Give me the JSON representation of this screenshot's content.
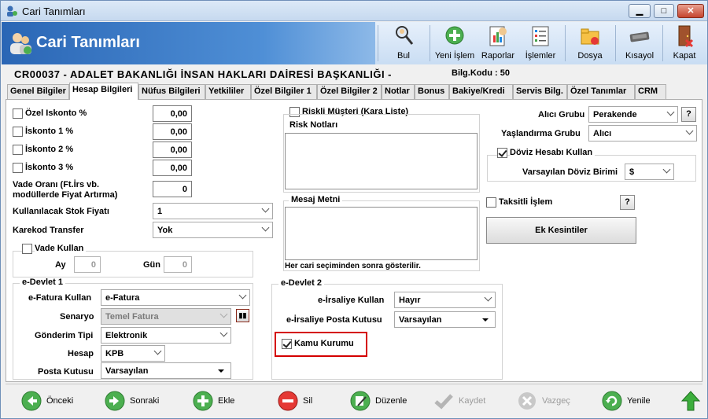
{
  "window": {
    "title": "Cari Tanımları"
  },
  "header": {
    "title": "Cari Tanımları"
  },
  "toolbar": {
    "bul": "Bul",
    "yeni_islem": "Yeni İşlem",
    "raporlar": "Raporlar",
    "islemler": "İşlemler",
    "dosya": "Dosya",
    "kisayol": "Kısayol",
    "kapat": "Kapat"
  },
  "info": {
    "cari_code": "CR00037  -  ADALET BAKANLIĞI İNSAN HAKLARI DAİRESİ BAŞKANLIĞI  -",
    "bilg_kodu": "Bilg.Kodu : 50"
  },
  "tabs": [
    "Genel Bilgiler",
    "Hesap Bilgileri",
    "Nüfus Bilgileri",
    "Yetkililer",
    "Özel Bilgiler 1",
    "Özel Bilgiler 2",
    "Notlar",
    "Bonus",
    "Bakiye/Kredi",
    "Servis Bilg.",
    "Özel Tanımlar",
    "CRM"
  ],
  "left": {
    "ozel_iskonto_label": "Özel Iskonto %",
    "ozel_iskonto_value": "0,00",
    "iskonto1_label": "İskonto 1 %",
    "iskonto1_value": "0,00",
    "iskonto2_label": "İskonto 2 %",
    "iskonto2_value": "0,00",
    "iskonto3_label": "İskonto 3 %",
    "iskonto3_value": "0,00",
    "vade_orani_label": "Vade Oranı (Ft.İrs vb. modüllerde Fiyat Artırma)",
    "vade_orani_value": "0",
    "stok_fiyati_label": "Kullanılacak Stok Fiyatı",
    "stok_fiyati_value": "1",
    "karekod_label": "Karekod Transfer",
    "karekod_value": "Yok",
    "vade_kullan_label": "Vade Kullan",
    "ay_label": "Ay",
    "ay_value": "0",
    "gun_label": "Gün",
    "gun_value": "0"
  },
  "edevlet1": {
    "title": "e-Devlet 1",
    "efatura_label": "e-Fatura Kullan",
    "efatura_value": "e-Fatura",
    "senaryo_label": "Senaryo",
    "senaryo_value": "Temel Fatura",
    "gonderim_label": "Gönderim Tipi",
    "gonderim_value": "Elektronik",
    "hesap_label": "Hesap",
    "hesap_value": "KPB",
    "posta_label": "Posta Kutusu",
    "posta_value": "Varsayılan"
  },
  "middle": {
    "riskli_label": "Riskli Müşteri (Kara Liste)",
    "risk_notlari_label": "Risk Notları",
    "mesaj_label": "Mesaj Metni",
    "mesaj_note": "Her cari seçiminden sonra gösterilir."
  },
  "edevlet2": {
    "title": "e-Devlet 2",
    "eirsaliye_label": "e-İrsaliye Kullan",
    "eirsaliye_value": "Hayır",
    "eirs_posta_label": "e-İrsaliye Posta Kutusu",
    "eirs_posta_value": "Varsayılan",
    "kamu_label": "Kamu Kurumu"
  },
  "right": {
    "alici_grubu_label": "Alıcı Grubu",
    "alici_grubu_value": "Perakende",
    "yaslandirma_label": "Yaşlandırma Grubu",
    "yaslandirma_value": "Alıcı",
    "doviz_label": "Döviz Hesabı Kullan",
    "doviz_birimi_label": "Varsayılan Döviz Birimi",
    "doviz_birimi_value": "$",
    "taksitli_label": "Taksitli İşlem",
    "help": "?",
    "ek_kesintiler": "Ek Kesintiler"
  },
  "footer": {
    "onceki": "Önceki",
    "sonraki": "Sonraki",
    "ekle": "Ekle",
    "sil": "Sil",
    "duzenle": "Düzenle",
    "kaydet": "Kaydet",
    "vazgec": "Vazgeç",
    "yenile": "Yenile"
  }
}
